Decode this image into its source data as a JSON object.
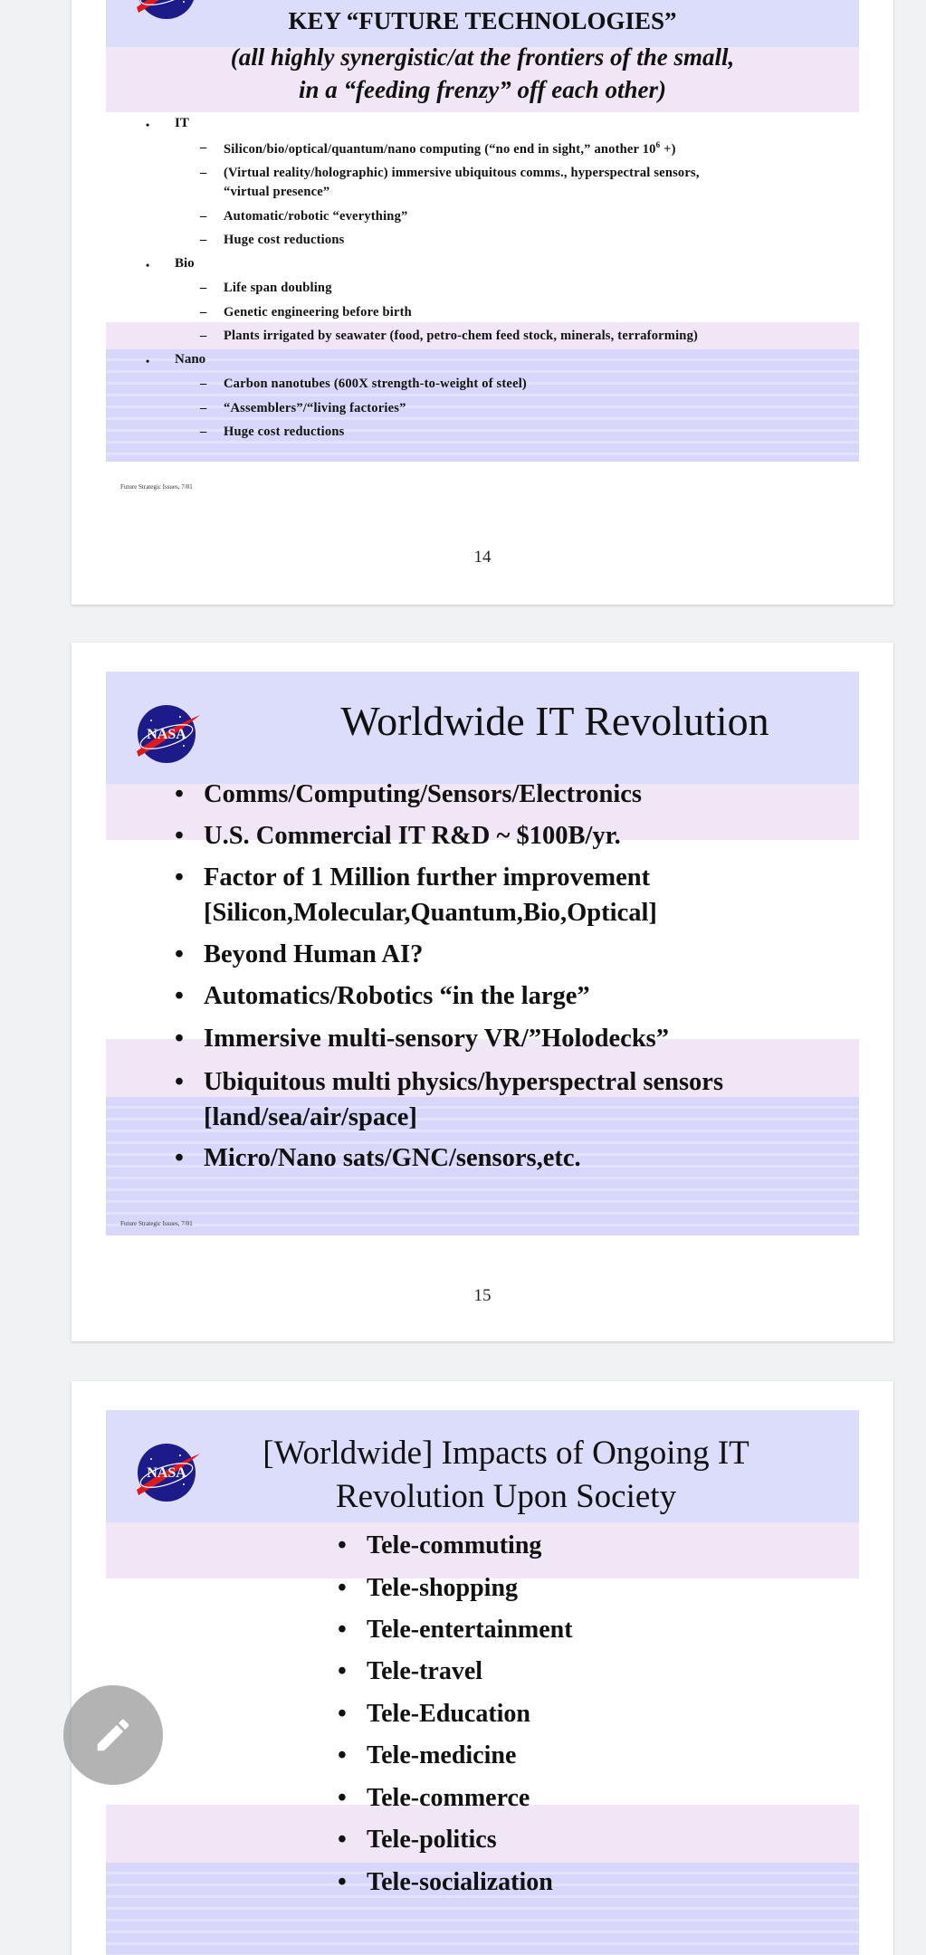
{
  "pages": [
    {
      "title": "KEY “FUTURE TECHNOLOGIES”",
      "subtitle_line1": "(all highly synergistic/at the frontiers of the small,",
      "subtitle_line2": "in a “feeding frenzy” off each other)",
      "sections": [
        {
          "label": "IT",
          "items": [
            "Silicon/bio/optical/quantum/nano computing (“no end in sight,” another 10",
            "(Virtual reality/holographic) immersive ubiquitous comms., hyperspectral sensors,",
            "Automatic/robotic “everything”",
            "Huge cost reductions"
          ],
          "sup": "6",
          "sup_tail": " +)",
          "cont": "“virtual presence”"
        },
        {
          "label": "Bio",
          "items": [
            "Life span doubling",
            "Genetic engineering before birth",
            "Plants irrigated by seawater (food, petro-chem feed stock, minerals, terraforming)"
          ]
        },
        {
          "label": "Nano",
          "items": [
            "Carbon nanotubes (600X strength-to-weight of steel)",
            "“Assemblers”/“living factories”",
            "Huge cost reductions"
          ]
        }
      ],
      "footer": "Future Strategic Issues, 7/01",
      "page_number": "14"
    },
    {
      "title": "Worldwide IT Revolution",
      "bullets": [
        "Comms/Computing/Sensors/Electronics",
        "U.S. Commercial IT R&D ~ $100B/yr.",
        "Factor of 1 Million further improvement",
        "[Silicon,Molecular,Quantum,Bio,Optical]",
        "Beyond Human AI?",
        "Automatics/Robotics “in the large”",
        "Immersive multi-sensory VR/”Holodecks”",
        "Ubiquitous multi physics/hyperspectral sensors",
        "[land/sea/air/space]",
        "Micro/Nano sats/GNC/sensors,etc."
      ],
      "footer": "Future Strategic Issues, 7/01",
      "page_number": "15"
    },
    {
      "title_line1": "[Worldwide] Impacts of Ongoing IT",
      "title_line2": "Revolution Upon Society",
      "bullets": [
        "Tele-commuting",
        "Tele-shopping",
        "Tele-entertainment",
        "Tele-travel",
        "Tele-Education",
        "Tele-medicine",
        "Tele-commerce",
        "Tele-politics",
        "Tele-socialization"
      ]
    }
  ],
  "logo": {
    "text": "NASA"
  },
  "fab": {
    "icon": "pencil-icon"
  },
  "colors": {
    "page_bg": "#f1f2f4",
    "slide_lavender": "#dcdcfb",
    "slide_pink": "#f1e6f5",
    "nasa_blue": "#1d1a8a",
    "nasa_red": "#e0191d",
    "fab": "#969696"
  }
}
